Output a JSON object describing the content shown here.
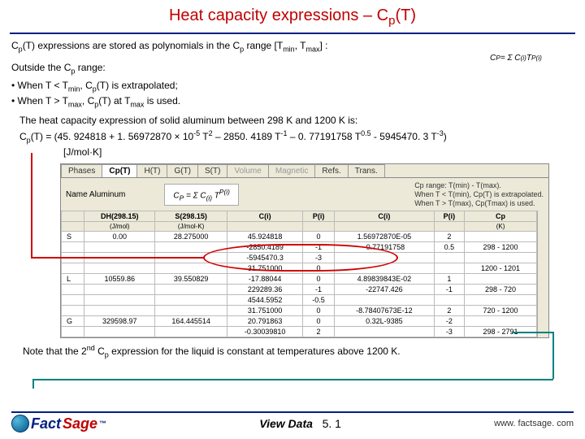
{
  "title_prefix": "Heat capacity expressions – C",
  "title_sub": "p",
  "title_suffix": "(T)",
  "intro_html": "C<span class=\"sub\">p</span>(T) expressions are stored as polynomials in the C<span class=\"sub\">p</span> range [T<span class=\"sub\">min</span>, T<span class=\"sub\">max</span>] :",
  "outside_lead_html": "Outside the C<span class=\"sub\">p</span> range:",
  "bullet1_html": "• When T &lt; T<span class=\"sub\">min</span>, C<span class=\"sub\">p</span>(T) is extrapolated;",
  "bullet2_html": "• When T &gt; T<span class=\"sub\">max</span>, C<span class=\"sub\">p</span>(T) at T<span class=\"sub\">max</span> is used.",
  "formula_display_html": "C<sub>P</sub> = Σ C<sub>(i)</sub> T<sup>P(i)</sup>",
  "example_line1_html": "The heat capacity expression of solid aluminum between 298 K and 1200 K is:",
  "example_line2_html": "C<span class=\"sub\">p</span>(T) = (45. 924818 + 1. 56972870 × 10<span class=\"sup\">-5</span> T<span class=\"sup\">2</span> – 2850. 4189 T<span class=\"sup\">-1</span> – 0. 77191758 T<span class=\"sup\">0.5</span> - 5945470. 3 T<span class=\"sup\">-3</span>)",
  "example_line3": "[J/mol·K]",
  "panel": {
    "tabs": [
      "Phases",
      "Cp(T)",
      "H(T)",
      "G(T)",
      "S(T)",
      "Volume",
      "Magnetic",
      "Refs.",
      "Trans."
    ],
    "active_tab_index": 1,
    "disabled_tabs": [
      5,
      6
    ],
    "name_label": "Name",
    "name_value": "Aluminum",
    "mini_formula_html": "C<sub>P</sub> = Σ C<sub>(i)</sub> T<sup>P(i)</sup>",
    "range_note_lines": [
      "Cp range: T(min) - T(max).",
      "When T < T(min), Cp(T) is extrapolated.",
      "When T > T(max), Cp(Tmax) is used."
    ],
    "headers_row1": [
      "",
      "DH(298.15)",
      "S(298.15)",
      "C(i)",
      "P(i)",
      "C(i)",
      "P(i)",
      "Cp"
    ],
    "headers_row2": [
      "",
      "(J/mol)",
      "(J/mol-K)",
      "",
      "",
      "",
      "",
      "(K)"
    ],
    "rows": [
      {
        "ph": "S",
        "dh": "0.00",
        "s": "28.275000",
        "c1": "45.924818",
        "p1": "0",
        "c2": "1.56972870E-05",
        "p2": "2",
        "range": ""
      },
      {
        "ph": "",
        "dh": "",
        "s": "",
        "c1": "-2850.4189",
        "p1": "-1",
        "c2": "-0.77191758",
        "p2": "0.5",
        "range": "298 - 1200"
      },
      {
        "ph": "",
        "dh": "",
        "s": "",
        "c1": "-5945470.3",
        "p1": "-3",
        "c2": "",
        "p2": "",
        "range": ""
      },
      {
        "ph": "",
        "dh": "",
        "s": "",
        "c1": "31.751000",
        "p1": "0",
        "c2": "",
        "p2": "",
        "range": "1200 - 1201"
      },
      {
        "ph": "L",
        "dh": "10559.86",
        "s": "39.550829",
        "c1": "-17.88044",
        "p1": "0",
        "c2": "4.89839843E-02",
        "p2": "1",
        "range": ""
      },
      {
        "ph": "",
        "dh": "",
        "s": "",
        "c1": "229289.36",
        "p1": "-1",
        "c2": "-22747.426",
        "p2": "-1",
        "range": "298 - 720"
      },
      {
        "ph": "",
        "dh": "",
        "s": "",
        "c1": "4544.5952",
        "p1": "-0.5",
        "c2": "",
        "p2": "",
        "range": ""
      },
      {
        "ph": "",
        "dh": "",
        "s": "",
        "c1": "31.751000",
        "p1": "0",
        "c2": "-8.78407673E-12",
        "p2": "2",
        "range": "720 - 1200"
      },
      {
        "ph": "G",
        "dh": "329598.97",
        "s": "164.445514",
        "c1": "20.791863",
        "p1": "0",
        "c2": "0.32L-9385",
        "p2": "-2",
        "range": ""
      },
      {
        "ph": "",
        "dh": "",
        "s": "",
        "c1": "-0.30039810",
        "p1": "2",
        "c2": "",
        "p2": "-3",
        "range": "298 - 2791"
      }
    ]
  },
  "note_html": "Note that the 2<span class=\"sup\">nd</span> C<span class=\"sub\">p</span> expression for the liquid is constant at temperatures above 1200 K.",
  "footer": {
    "brand_main": "Fact",
    "brand_tail": "Sage",
    "tm": "™",
    "center_strong": "View Data",
    "center_num": "5. 1",
    "url": "www. factsage. com"
  }
}
